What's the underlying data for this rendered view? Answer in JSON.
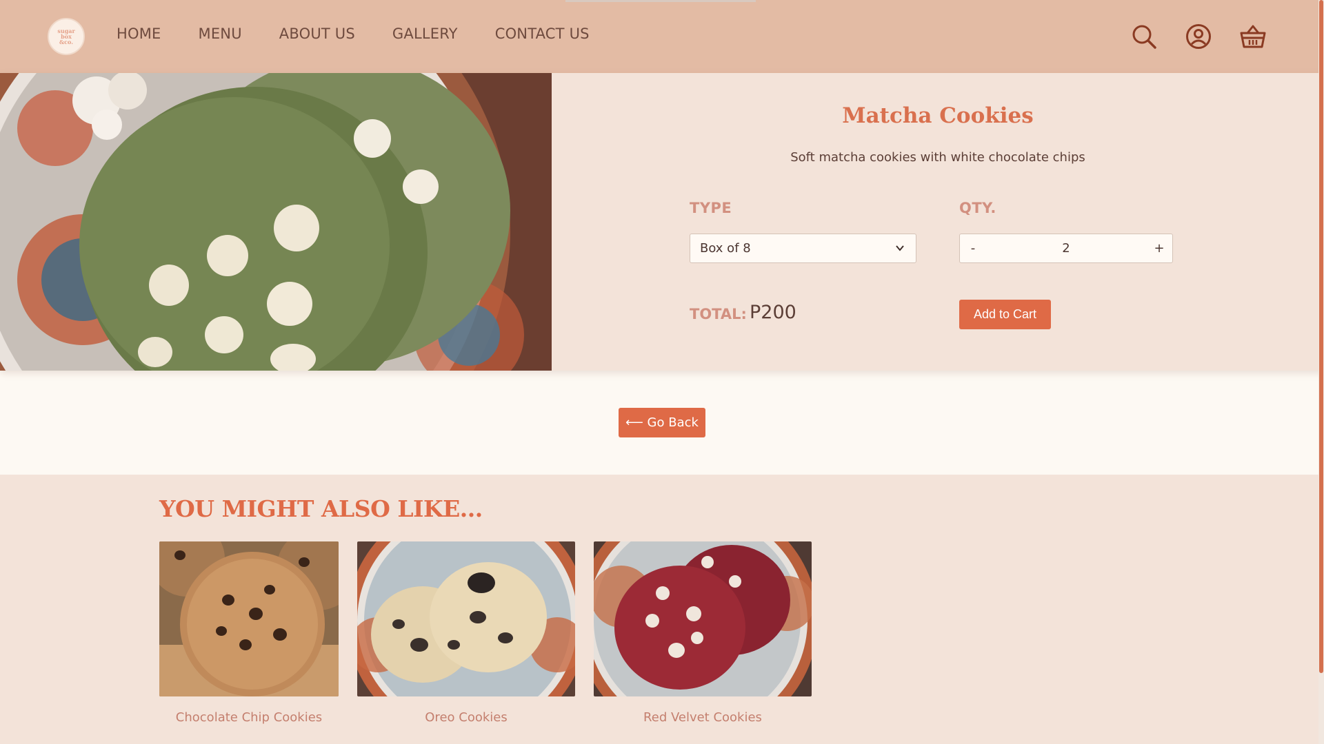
{
  "logo": {
    "lines": [
      "sugar",
      "box",
      "&co."
    ]
  },
  "nav": {
    "links": [
      "HOME",
      "MENU",
      "ABOUT US",
      "GALLERY",
      "CONTACT US"
    ],
    "icons": [
      "search-icon",
      "user-icon",
      "basket-icon"
    ]
  },
  "product": {
    "title": "Matcha Cookies",
    "description": "Soft matcha cookies with white chocolate chips",
    "type_label": "TYPE",
    "type_value": "Box of 8",
    "qty_label": "QTY.",
    "qty_minus": "-",
    "qty_value": "2",
    "qty_plus": "+",
    "total_label": "TOTAL:",
    "total_value": "P200",
    "add_to_cart": "Add to Cart"
  },
  "back": {
    "label": "⟵ Go Back"
  },
  "related": {
    "title": "YOU MIGHT ALSO LIKE...",
    "items": [
      {
        "label": "Chocolate Chip Cookies"
      },
      {
        "label": "Oreo Cookies"
      },
      {
        "label": "Red Velvet Cookies"
      }
    ]
  },
  "colors": {
    "nav_bg": "#e3bba4",
    "accent": "#df6a46",
    "panel_bg": "#f3e3d9",
    "page_bg": "#fdf9f3"
  }
}
